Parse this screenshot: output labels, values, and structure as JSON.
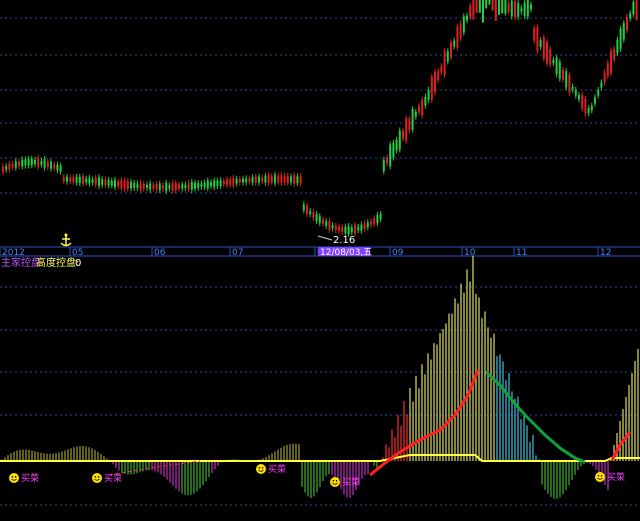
{
  "axis": {
    "months": [
      "2012",
      "05",
      "06",
      "07",
      "08",
      "09",
      "10",
      "11",
      "12"
    ],
    "cursor_date": "12/08/03,五"
  },
  "price_panel": {
    "low_label": "2.16"
  },
  "indicator_panel": {
    "legend_main": "主家控盘",
    "legend_height_label": "高度控盘:",
    "legend_height_value": "0"
  },
  "markers": [
    {
      "label": "买菜"
    },
    {
      "label": "买菜"
    },
    {
      "label": "买菜"
    },
    {
      "label": "买菜"
    },
    {
      "label": "买菜"
    }
  ],
  "colors": {
    "grid": "#2a4aa0",
    "up_candle": "#e02020",
    "down_candle": "#20d040",
    "axis_line": "#3050c0",
    "cursor_bg": "#8040ff",
    "yellow_line": "#ffff40",
    "red_line": "#ff2020",
    "green_line": "#10a040",
    "bar_green": "#40b030",
    "bar_magenta": "#c030c0",
    "bar_red": "#ff3030",
    "bar_yellow": "#e0e060",
    "bar_cyan": "#40c0e0",
    "bar_olive": "#a0a030"
  }
}
